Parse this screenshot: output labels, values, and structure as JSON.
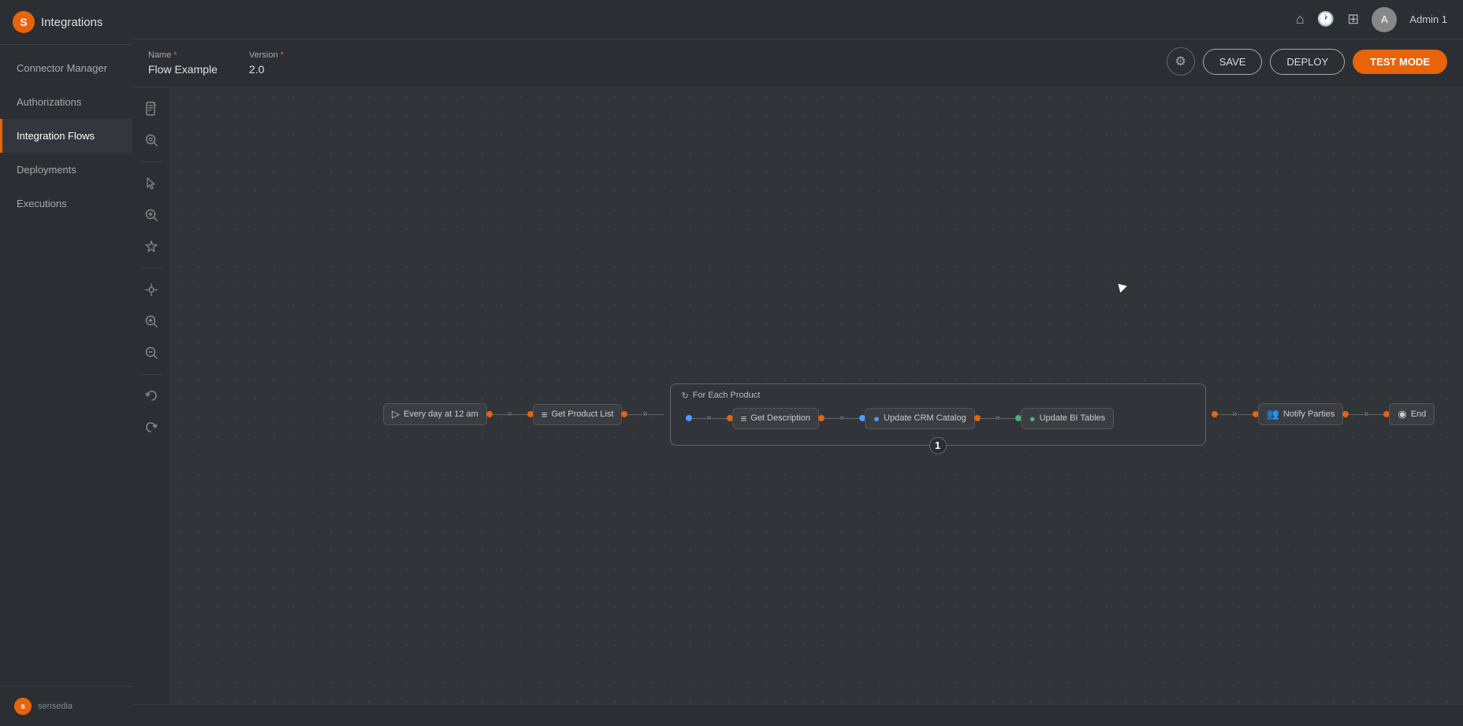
{
  "app": {
    "logo_text": "Integrations",
    "logo_initial": "S"
  },
  "sidebar": {
    "items": [
      {
        "id": "connector-manager",
        "label": "Connector Manager",
        "active": false
      },
      {
        "id": "authorizations",
        "label": "Authorizations",
        "active": false
      },
      {
        "id": "integration-flows",
        "label": "Integration Flows",
        "active": true
      },
      {
        "id": "deployments",
        "label": "Deployments",
        "active": false
      },
      {
        "id": "executions",
        "label": "Executions",
        "active": false
      }
    ],
    "footer_text": "sensedia"
  },
  "topbar": {
    "home_icon": "⌂",
    "clock_icon": "🕐",
    "grid_icon": "⊞",
    "user_initial": "A",
    "user_name": "Admin 1"
  },
  "header": {
    "name_label": "Name",
    "name_required": "*",
    "name_value": "Flow Example",
    "version_label": "Version",
    "version_required": "*",
    "version_value": "2.0",
    "settings_icon": "⚙",
    "save_label": "SAVE",
    "deploy_label": "DEPLOY",
    "test_mode_label": "TEST MODE"
  },
  "toolbar": {
    "tools": [
      {
        "id": "doc",
        "icon": "📄"
      },
      {
        "id": "search-node",
        "icon": "🔍"
      },
      {
        "id": "pointer",
        "icon": "↖"
      },
      {
        "id": "search-zoom",
        "icon": "🔎"
      },
      {
        "id": "star",
        "icon": "✦"
      },
      {
        "id": "center",
        "icon": "⊙"
      },
      {
        "id": "zoom-in",
        "icon": "+"
      },
      {
        "id": "zoom-out",
        "icon": "−"
      },
      {
        "id": "undo",
        "icon": "↺"
      },
      {
        "id": "redo",
        "icon": "↻"
      }
    ]
  },
  "flow": {
    "trigger_label": "Every day at 12 am",
    "trigger_icon": "▷",
    "get_product_list_label": "Get Product List",
    "get_product_list_icon": "≡",
    "loop_label": "For Each Product",
    "loop_icon": "↻",
    "get_description_label": "Get Description",
    "get_description_icon": "≡",
    "update_crm_label": "Update CRM Catalog",
    "update_crm_icon": "🔵",
    "update_bi_label": "Update BI Tables",
    "update_bi_icon": "🟢",
    "notify_parties_label": "Notify Parties",
    "notify_parties_icon": "👥",
    "end_label": "End",
    "end_icon": "◉",
    "badge_number": "1"
  },
  "bottom_bar": {
    "text": ""
  }
}
